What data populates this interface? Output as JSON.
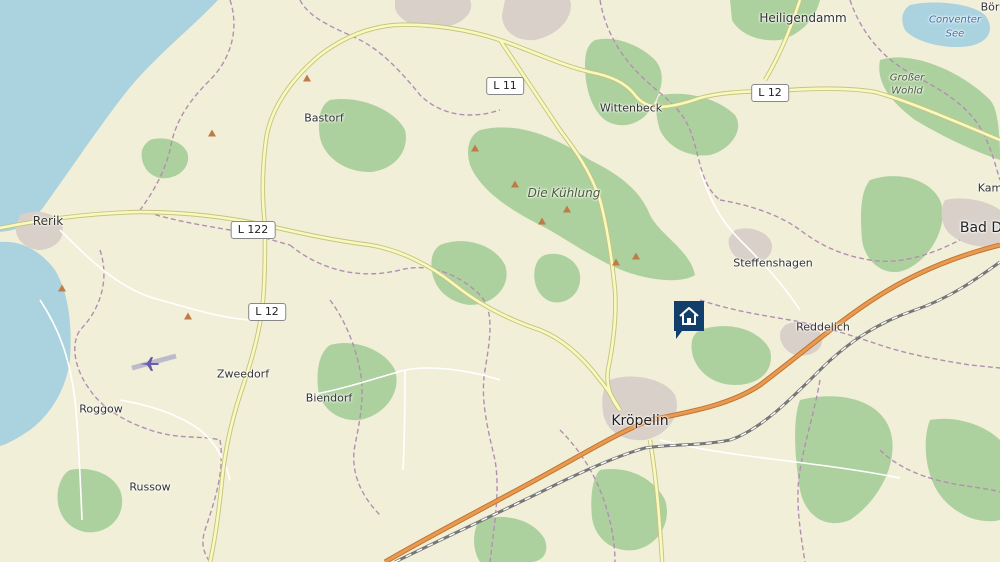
{
  "map": {
    "places": {
      "heiligendamm": "Heiligendamm",
      "boergerende": "Bör",
      "conventer_see_line1": "Conventer",
      "conventer_see_line2": "See",
      "grosser_wohld_line1": "Großer",
      "grosser_wohld_line2": "Wohld",
      "bastorf": "Bastorf",
      "wittenbeck": "Wittenbeck",
      "die_kuehlung": "Die Kühlung",
      "rerik": "Rerik",
      "kamp": "Kam",
      "bad_doberan": "Bad D",
      "steffenshagen": "Steffenshagen",
      "reddelich": "Reddelich",
      "zweedorf": "Zweedorf",
      "biendorf": "Biendorf",
      "roggow": "Roggow",
      "kroepelin": "Kröpelin",
      "russow": "Russow"
    },
    "roads": {
      "l11": "L 11",
      "l12_east": "L 12",
      "l122": "L 122",
      "l12_south": "L 12"
    },
    "icons": {
      "location_marker": "home-icon",
      "airfield": "airplane-icon",
      "peak": "peak-icon"
    },
    "colors": {
      "land": "#f2efd9",
      "forest": "#add19e",
      "water": "#aad3df",
      "marker": "#123e6b",
      "road_secondary": "#f7fabf",
      "road_outline": "#c9c380",
      "motorway": "#e99a52",
      "rail": "#777777",
      "boundary": "#b28fb2"
    }
  }
}
